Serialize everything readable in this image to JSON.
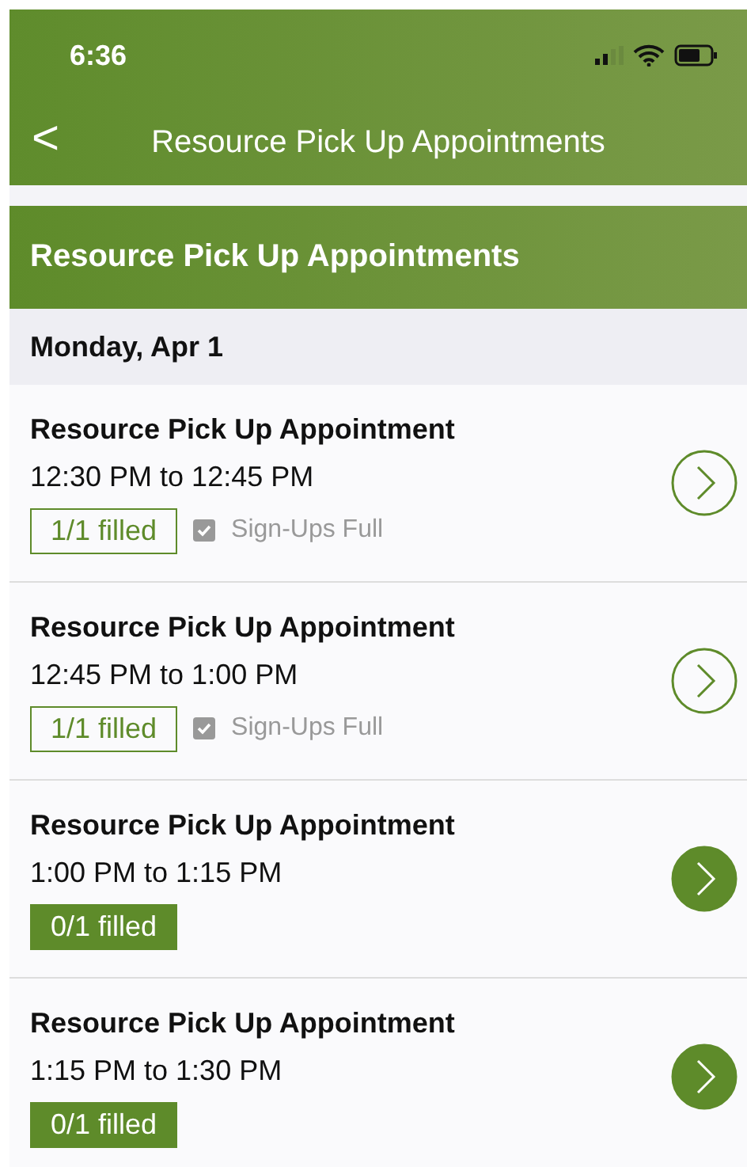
{
  "status_bar": {
    "time": "6:36"
  },
  "nav": {
    "back": "<",
    "title": "Resource Pick Up Appointments"
  },
  "section": {
    "title": "Resource Pick Up Appointments"
  },
  "date_header": "Monday, Apr 1",
  "appointments": [
    {
      "title": "Resource Pick Up Appointment",
      "time": "12:30 PM to 12:45 PM",
      "filled": "1/1 filled",
      "full": true,
      "full_label": "Sign-Ups Full"
    },
    {
      "title": "Resource Pick Up Appointment",
      "time": "12:45 PM to 1:00 PM",
      "filled": "1/1 filled",
      "full": true,
      "full_label": "Sign-Ups Full"
    },
    {
      "title": "Resource Pick Up Appointment",
      "time": "1:00 PM to 1:15 PM",
      "filled": "0/1 filled",
      "full": false
    },
    {
      "title": "Resource Pick Up Appointment",
      "time": "1:15 PM to 1:30 PM",
      "filled": "0/1 filled",
      "full": false
    }
  ]
}
